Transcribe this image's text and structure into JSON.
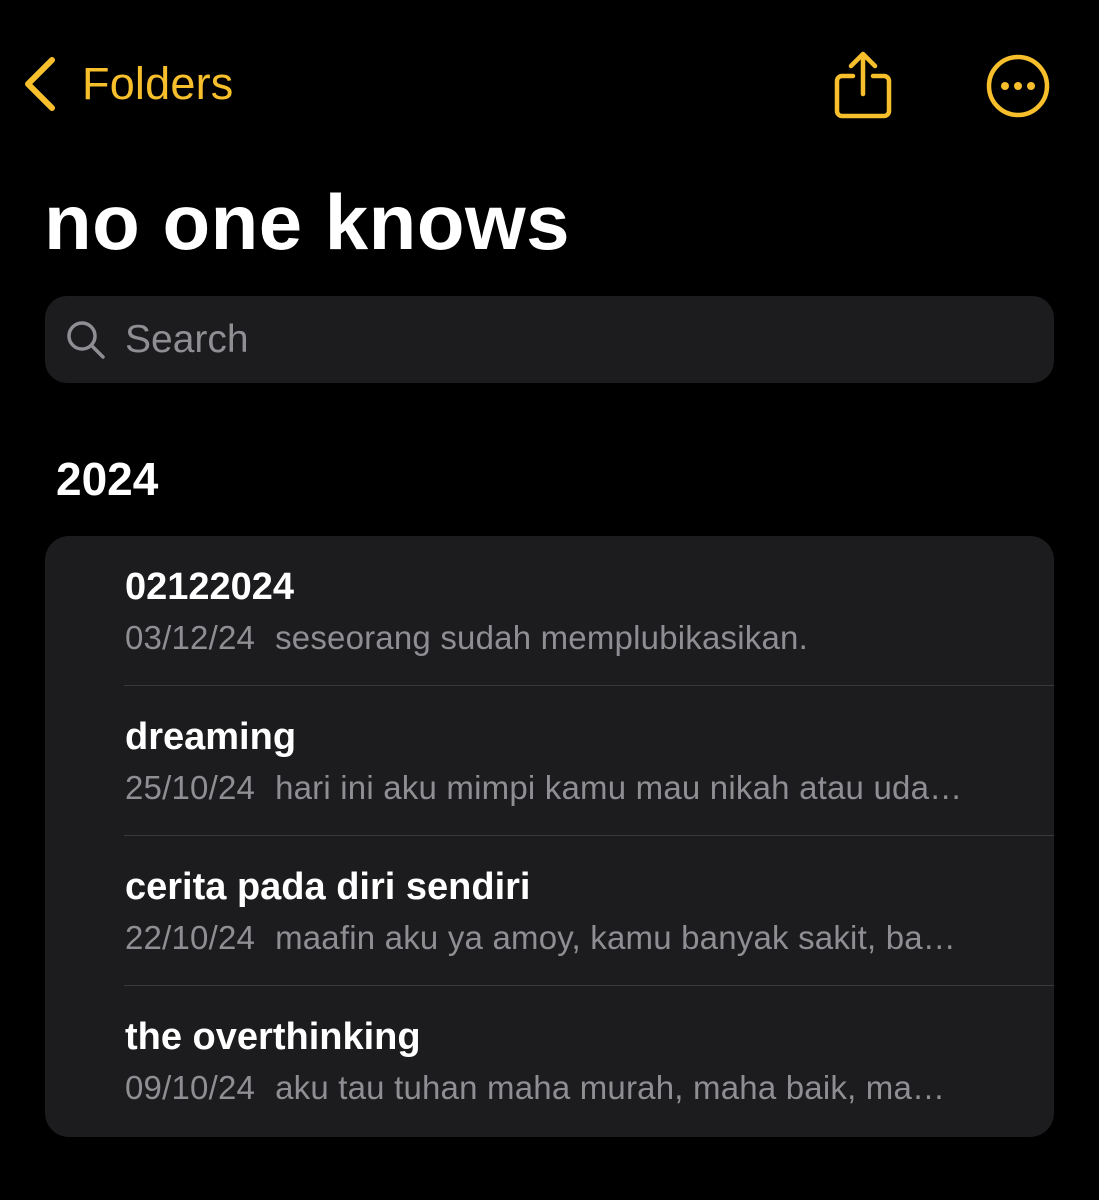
{
  "nav": {
    "back_label": "Folders",
    "accent_color": "#f7bf2b",
    "icons": {
      "back": "chevron-left-icon",
      "share": "share-icon",
      "more": "ellipsis-circle-icon"
    }
  },
  "title": "no one knows",
  "search": {
    "placeholder": "Search",
    "value": ""
  },
  "section": {
    "header": "2024",
    "notes": [
      {
        "title": "02122024",
        "date": "03/12/24",
        "preview": "seseorang sudah memplubikasikan."
      },
      {
        "title": "dreaming",
        "date": "25/10/24",
        "preview": "hari ini aku mimpi kamu mau nikah atau uda…"
      },
      {
        "title": "cerita pada diri sendiri",
        "date": "22/10/24",
        "preview": "maafin aku ya amoy, kamu banyak sakit, ba…"
      },
      {
        "title": "the overthinking",
        "date": "09/10/24",
        "preview": "aku tau tuhan maha murah, maha baik, ma…"
      }
    ]
  }
}
